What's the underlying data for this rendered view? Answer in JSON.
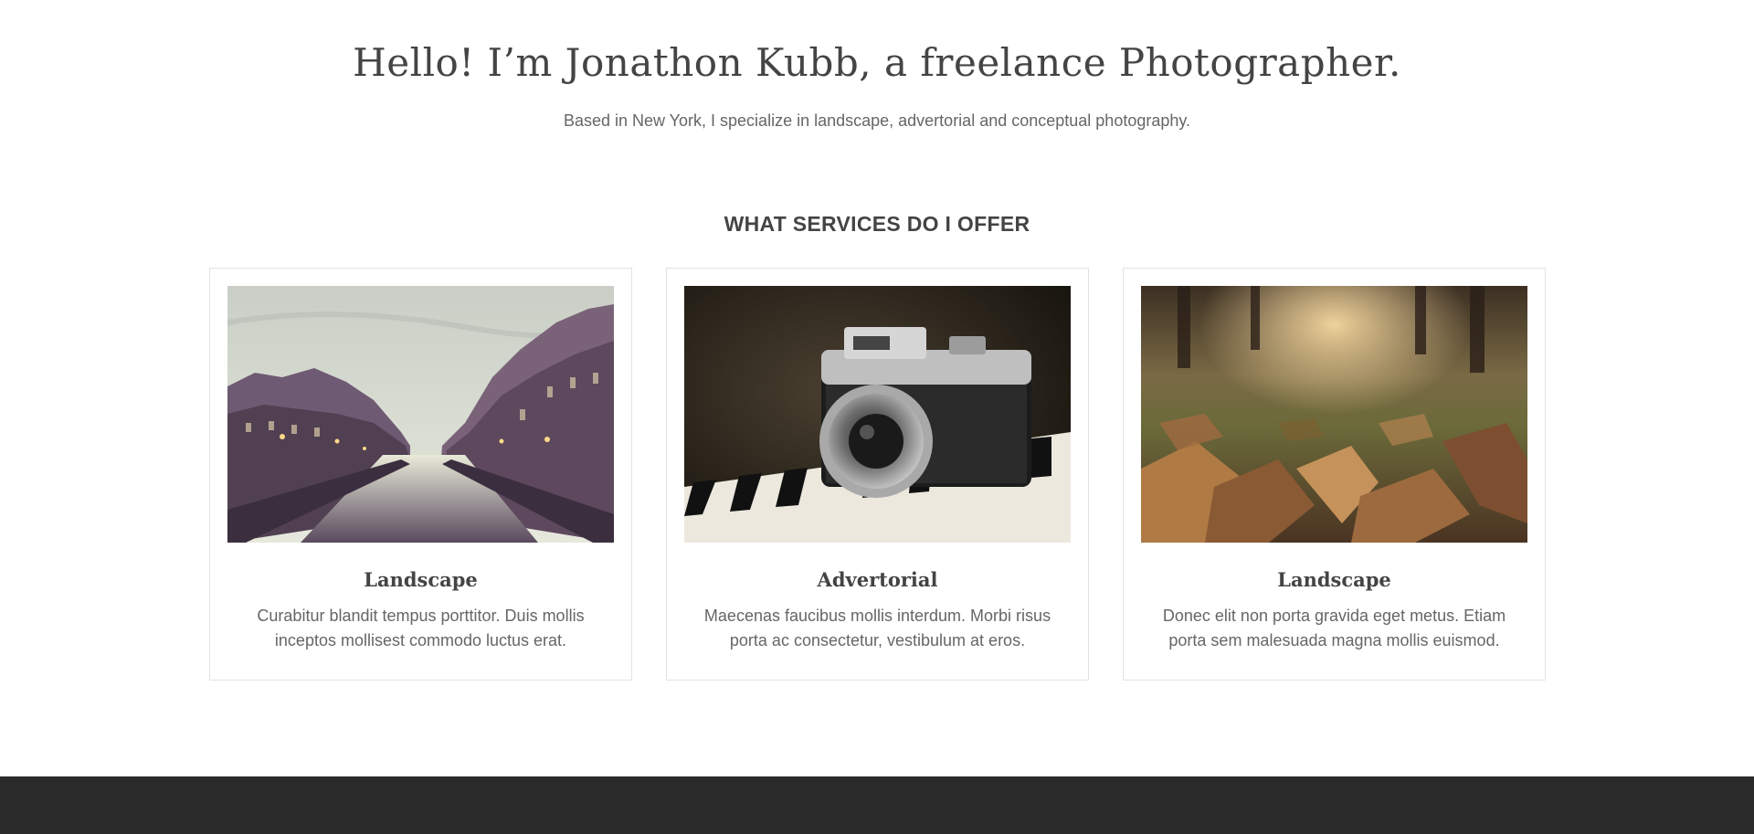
{
  "hero": {
    "title": "Hello! I’m Jonathon Kubb, a freelance Photographer.",
    "subtitle": "Based in New York, I specialize in landscape, advertorial and conceptual photography."
  },
  "services": {
    "heading": "WHAT SERVICES DO I OFFER",
    "cards": [
      {
        "title": "Landscape",
        "text": "Curabitur blandit tempus porttitor. Duis mollis inceptos mollisest commodo luctus erat.",
        "image": "canal-city-photo"
      },
      {
        "title": "Advertorial",
        "text": "Maecenas faucibus mollis interdum. Morbi risus porta ac consectetur, vestibulum at eros.",
        "image": "vintage-camera-on-piano-photo"
      },
      {
        "title": "Landscape",
        "text": "Donec elit non porta gravida eget metus. Etiam porta sem malesuada magna mollis euismod.",
        "image": "autumn-leaves-photo"
      }
    ]
  },
  "colors": {
    "heading": "#444444",
    "body_text": "#666666",
    "card_border": "#e3e3e3",
    "footer": "#2a2a2a"
  }
}
